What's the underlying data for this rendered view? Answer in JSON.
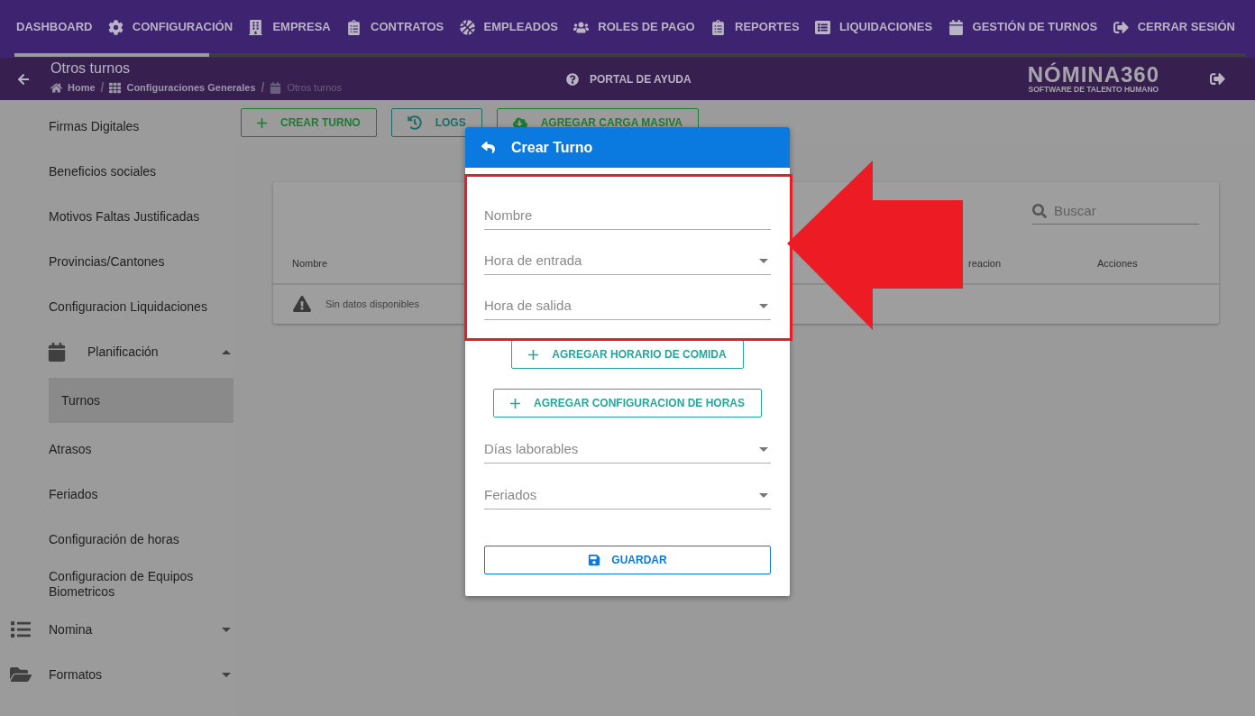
{
  "top_nav": [
    {
      "label": "DASHBOARD"
    },
    {
      "label": "CONFIGURACIÓN"
    },
    {
      "label": "EMPRESA"
    },
    {
      "label": "CONTRATOS"
    },
    {
      "label": "EMPLEADOS"
    },
    {
      "label": "ROLES DE PAGO"
    },
    {
      "label": "REPORTES"
    },
    {
      "label": "LIQUIDACIONES"
    },
    {
      "label": "GESTIÓN DE TURNOS"
    },
    {
      "label": "CERRAR SESIÓN"
    }
  ],
  "loading": {
    "level": 0.158
  },
  "header": {
    "title": "Otros turnos",
    "separator": "/",
    "breadcrumbs": [
      {
        "label": "Home"
      },
      {
        "label": "Configuraciones Generales"
      },
      {
        "label": "Otros turnos"
      }
    ],
    "help": "PORTAL DE AYUDA",
    "logo": {
      "name": "NÓMINA360",
      "tagline": "SOFTWARE DE TALENTO HUMANO"
    }
  },
  "sidebar": {
    "items": [
      {
        "kind": "link",
        "label": "Firmas Digitales"
      },
      {
        "kind": "link",
        "label": "Beneficios sociales"
      },
      {
        "kind": "link",
        "label": "Motivos Faltas Justificadas"
      },
      {
        "kind": "link",
        "label": "Provincias/Cantones"
      },
      {
        "kind": "link",
        "label": "Configuracion Liquidaciones"
      },
      {
        "kind": "group",
        "label": "Planificación",
        "expanded": true,
        "children": [
          {
            "label": "Turnos",
            "selected": true
          }
        ]
      },
      {
        "kind": "link",
        "label": "Atrasos"
      },
      {
        "kind": "link",
        "label": "Feriados"
      },
      {
        "kind": "link",
        "label": "Configuración de horas"
      },
      {
        "kind": "link",
        "label": "Configuracion de Equipos Biometricos"
      },
      {
        "kind": "section",
        "label": "Nomina",
        "expanded": false
      },
      {
        "kind": "section",
        "label": "Formatos",
        "expanded": false
      }
    ]
  },
  "toolbar": [
    "CREAR TURNO",
    "LOGS",
    "AGREGAR CARGA MASIVA"
  ],
  "table": {
    "search": {
      "placeholder": "Buscar"
    },
    "columns": [
      "Nombre",
      "reacion",
      "Acciones"
    ],
    "empty": "Sin datos disponibles"
  },
  "dialog": {
    "title": "Crear Turno",
    "fields": [
      {
        "kind": "text",
        "placeholder": "Nombre"
      },
      {
        "kind": "select",
        "placeholder": "Hora de entrada"
      },
      {
        "kind": "select",
        "placeholder": "Hora de salida"
      }
    ],
    "actions": [
      "AGREGAR HORARIO DE COMIDA",
      "AGREGAR CONFIGURACION DE HORAS"
    ],
    "more_fields": [
      {
        "kind": "select",
        "placeholder": "Días laborables"
      },
      {
        "kind": "select",
        "placeholder": "Feriados"
      }
    ],
    "save": "GUARDAR"
  }
}
